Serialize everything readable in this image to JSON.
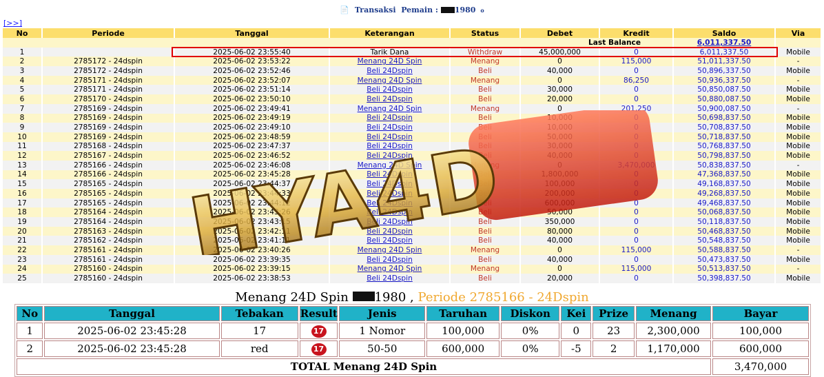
{
  "header": {
    "icon": "📄",
    "title_prefix": "Transaksi",
    "title_label": "Pemain :",
    "player_suffix": "1980",
    "info_icon": "o"
  },
  "nav": {
    "next_label": "[>>]"
  },
  "table": {
    "columns": [
      "No",
      "Periode",
      "Tanggal",
      "Keterangan",
      "Status",
      "Debet",
      "Kredit",
      "Saldo",
      "Via"
    ],
    "last_balance_label": "Last Balance",
    "last_balance_value": "6,011,337.50",
    "rows": [
      {
        "no": "1",
        "periode": "",
        "tanggal": "2025-06-02 23:55:40",
        "ket": "Tarik Dana",
        "status": "Withdraw",
        "debet": "45,000,000",
        "kredit": "0",
        "saldo": "6,011,337.50",
        "via": "Mobile"
      },
      {
        "no": "2",
        "periode": "2785172 - 24dspin",
        "tanggal": "2025-06-02 23:53:22",
        "ket": "Menang 24D Spin",
        "status": "Menang",
        "debet": "0",
        "kredit": "115,000",
        "saldo": "51,011,337.50",
        "via": "-"
      },
      {
        "no": "3",
        "periode": "2785172 - 24dspin",
        "tanggal": "2025-06-02 23:52:46",
        "ket": "Beli 24Dspin",
        "status": "Beli",
        "debet": "40,000",
        "kredit": "0",
        "saldo": "50,896,337.50",
        "via": "Mobile"
      },
      {
        "no": "4",
        "periode": "2785171 - 24dspin",
        "tanggal": "2025-06-02 23:52:07",
        "ket": "Menang 24D Spin",
        "status": "Menang",
        "debet": "0",
        "kredit": "86,250",
        "saldo": "50,936,337.50",
        "via": "-"
      },
      {
        "no": "5",
        "periode": "2785171 - 24dspin",
        "tanggal": "2025-06-02 23:51:14",
        "ket": "Beli 24Dspin",
        "status": "Beli",
        "debet": "30,000",
        "kredit": "0",
        "saldo": "50,850,087.50",
        "via": "Mobile"
      },
      {
        "no": "6",
        "periode": "2785170 - 24dspin",
        "tanggal": "2025-06-02 23:50:10",
        "ket": "Beli 24Dspin",
        "status": "Beli",
        "debet": "20,000",
        "kredit": "0",
        "saldo": "50,880,087.50",
        "via": "Mobile"
      },
      {
        "no": "7",
        "periode": "2785169 - 24dspin",
        "tanggal": "2025-06-02 23:49:41",
        "ket": "Menang 24D Spin",
        "status": "Menang",
        "debet": "0",
        "kredit": "201,250",
        "saldo": "50,900,087.50",
        "via": "-"
      },
      {
        "no": "8",
        "periode": "2785169 - 24dspin",
        "tanggal": "2025-06-02 23:49:19",
        "ket": "Beli 24Dspin",
        "status": "Beli",
        "debet": "10,000",
        "kredit": "0",
        "saldo": "50,698,837.50",
        "via": "Mobile"
      },
      {
        "no": "9",
        "periode": "2785169 - 24dspin",
        "tanggal": "2025-06-02 23:49:10",
        "ket": "Beli 24Dspin",
        "status": "Beli",
        "debet": "10,000",
        "kredit": "0",
        "saldo": "50,708,837.50",
        "via": "Mobile"
      },
      {
        "no": "10",
        "periode": "2785169 - 24dspin",
        "tanggal": "2025-06-02 23:48:59",
        "ket": "Beli 24Dspin",
        "status": "Beli",
        "debet": "50,000",
        "kredit": "0",
        "saldo": "50,718,837.50",
        "via": "Mobile"
      },
      {
        "no": "11",
        "periode": "2785168 - 24dspin",
        "tanggal": "2025-06-02 23:47:37",
        "ket": "Beli 24Dspin",
        "status": "Beli",
        "debet": "30,000",
        "kredit": "0",
        "saldo": "50,768,837.50",
        "via": "Mobile"
      },
      {
        "no": "12",
        "periode": "2785167 - 24dspin",
        "tanggal": "2025-06-02 23:46:52",
        "ket": "Beli 24Dspin",
        "status": "Beli",
        "debet": "40,000",
        "kredit": "0",
        "saldo": "50,798,837.50",
        "via": "Mobile"
      },
      {
        "no": "13",
        "periode": "2785166 - 24dspin",
        "tanggal": "2025-06-02 23:46:08",
        "ket": "Menang 24D Spin",
        "status": "Menang",
        "debet": "0",
        "kredit": "3,470,000",
        "saldo": "50,838,837.50",
        "via": "-"
      },
      {
        "no": "14",
        "periode": "2785166 - 24dspin",
        "tanggal": "2025-06-02 23:45:28",
        "ket": "Beli 24Dspin",
        "status": "Beli",
        "debet": "1,800,000",
        "kredit": "0",
        "saldo": "47,368,837.50",
        "via": "Mobile"
      },
      {
        "no": "15",
        "periode": "2785165 - 24dspin",
        "tanggal": "2025-06-02 23:44:37",
        "ket": "Beli 24Dspin",
        "status": "Beli",
        "debet": "100,000",
        "kredit": "0",
        "saldo": "49,168,837.50",
        "via": "Mobile"
      },
      {
        "no": "16",
        "periode": "2785165 - 24dspin",
        "tanggal": "2025-06-02 23:44:33",
        "ket": "Beli 24Dspin",
        "status": "Beli",
        "debet": "200,000",
        "kredit": "0",
        "saldo": "49,268,837.50",
        "via": "Mobile"
      },
      {
        "no": "17",
        "periode": "2785165 - 24dspin",
        "tanggal": "2025-06-02 23:44:12",
        "ket": "Beli 24Dspin",
        "status": "Beli",
        "debet": "600,000",
        "kredit": "0",
        "saldo": "49,468,837.50",
        "via": "Mobile"
      },
      {
        "no": "18",
        "periode": "2785164 - 24dspin",
        "tanggal": "2025-06-02 23:43:26",
        "ket": "Beli 24Dspin",
        "status": "Beli",
        "debet": "50,000",
        "kredit": "0",
        "saldo": "50,068,837.50",
        "via": "Mobile"
      },
      {
        "no": "19",
        "periode": "2785164 - 24dspin",
        "tanggal": "2025-06-02 23:43:15",
        "ket": "Beli 24Dspin",
        "status": "Beli",
        "debet": "350,000",
        "kredit": "0",
        "saldo": "50,118,837.50",
        "via": "Mobile"
      },
      {
        "no": "20",
        "periode": "2785163 - 24dspin",
        "tanggal": "2025-06-02 23:42:11",
        "ket": "Beli 24Dspin",
        "status": "Beli",
        "debet": "80,000",
        "kredit": "0",
        "saldo": "50,468,837.50",
        "via": "Mobile"
      },
      {
        "no": "21",
        "periode": "2785162 - 24dspin",
        "tanggal": "2025-06-02 23:41:11",
        "ket": "Beli 24Dspin",
        "status": "Beli",
        "debet": "40,000",
        "kredit": "0",
        "saldo": "50,548,837.50",
        "via": "Mobile"
      },
      {
        "no": "22",
        "periode": "2785161 - 24dspin",
        "tanggal": "2025-06-02 23:40:26",
        "ket": "Menang 24D Spin",
        "status": "Menang",
        "debet": "0",
        "kredit": "115,000",
        "saldo": "50,588,837.50",
        "via": "-"
      },
      {
        "no": "23",
        "periode": "2785161 - 24dspin",
        "tanggal": "2025-06-02 23:39:35",
        "ket": "Beli 24Dspin",
        "status": "Beli",
        "debet": "40,000",
        "kredit": "0",
        "saldo": "50,473,837.50",
        "via": "Mobile"
      },
      {
        "no": "24",
        "periode": "2785160 - 24dspin",
        "tanggal": "2025-06-02 23:39:15",
        "ket": "Menang 24D Spin",
        "status": "Menang",
        "debet": "0",
        "kredit": "115,000",
        "saldo": "50,513,837.50",
        "via": "-"
      },
      {
        "no": "25",
        "periode": "2785160 - 24dspin",
        "tanggal": "2025-06-02 23:38:53",
        "ket": "Beli 24Dspin",
        "status": "Beli",
        "debet": "20,000",
        "kredit": "0",
        "saldo": "50,398,837.50",
        "via": "Mobile"
      }
    ]
  },
  "watermark": {
    "text": "HYA4D"
  },
  "win": {
    "title_prefix": "Menang 24D Spin",
    "player_suffix": "1980 ,",
    "periode": "Periode 2785166 - 24Dspin",
    "columns": [
      "No",
      "Tanggal",
      "Tebakan",
      "Result",
      "Jenis",
      "Taruhan",
      "Diskon",
      "Kei",
      "Prize",
      "Menang",
      "Bayar"
    ],
    "rows": [
      {
        "no": "1",
        "tanggal": "2025-06-02 23:45:28",
        "tebakan": "17",
        "result": "17",
        "jenis": "1 Nomor",
        "taruhan": "100,000",
        "diskon": "0%",
        "kei": "0",
        "prize": "23",
        "menang": "2,300,000",
        "bayar": "100,000"
      },
      {
        "no": "2",
        "tanggal": "2025-06-02 23:45:28",
        "tebakan": "red",
        "result": "17",
        "jenis": "50-50",
        "taruhan": "600,000",
        "diskon": "0%",
        "kei": "-5",
        "prize": "2",
        "menang": "1,170,000",
        "bayar": "600,000"
      }
    ],
    "total_label": "TOTAL  Menang 24D Spin",
    "total_value": "3,470,000"
  },
  "colors": {
    "header_bg": "#fcde6c",
    "row_odd": "#f2f2f2",
    "row_even": "#fdf6c9",
    "link": "#1a1ac8",
    "status_red": "#c0392b",
    "highlight": "#e00000",
    "win_header": "#20b2c8",
    "result_ball": "#c8141e",
    "periode_orange": "#f0a830"
  }
}
